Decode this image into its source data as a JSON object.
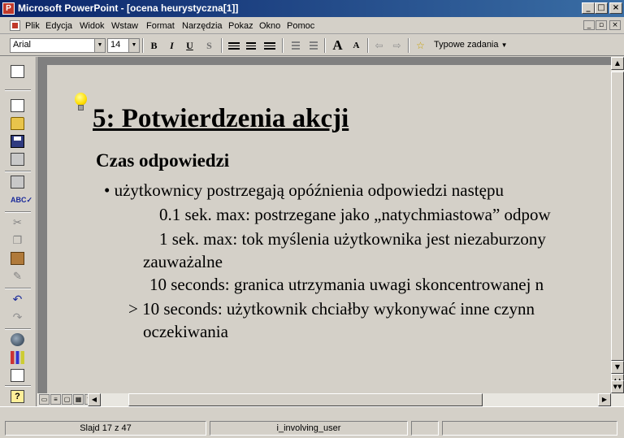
{
  "window": {
    "title": "Microsoft PowerPoint - [ocena heurystyczna[1]]",
    "min": "_",
    "max": "□",
    "close": "×"
  },
  "menu": {
    "items": [
      "Plik",
      "Edycja",
      "Widok",
      "Wstaw",
      "Format",
      "Narzędzia",
      "Pokaz",
      "Okno",
      "Pomoc"
    ],
    "mdi_min": "_",
    "mdi_restore": "▫",
    "mdi_close": "×"
  },
  "toolbar": {
    "font": "Arial",
    "size": "14",
    "bold": "B",
    "italic": "I",
    "underline": "U",
    "shadow": "S",
    "increase_font": "A",
    "decrease_font": "A",
    "task_pane": "Typowe zadania"
  },
  "slide": {
    "title": "5: Potwierdzenia akcji",
    "subheading": "Czas odpowiedzi",
    "bullet": "• użytkownicy postrzegają opóźnienia odpowiedzi następu",
    "lines": [
      "0.1  sek. max: postrzegane jako „natychmiastowa” odpow",
      "1     sek. max: tok myślenia użytkownika jest niezaburzony",
      "zauważalne",
      "10     seconds: granica utrzymania uwagi skoncentrowanej n",
      ">  10     seconds: użytkownik chciałby wykonywać inne czynn",
      "oczekiwania"
    ]
  },
  "status": {
    "slide": "Slajd 17 z 47",
    "design": "i_involving_user"
  },
  "colors": {
    "titlebar_start": "#0a246a",
    "titlebar_end": "#3a6ea5",
    "chrome": "#d4d0c8",
    "workspace": "#808080"
  }
}
